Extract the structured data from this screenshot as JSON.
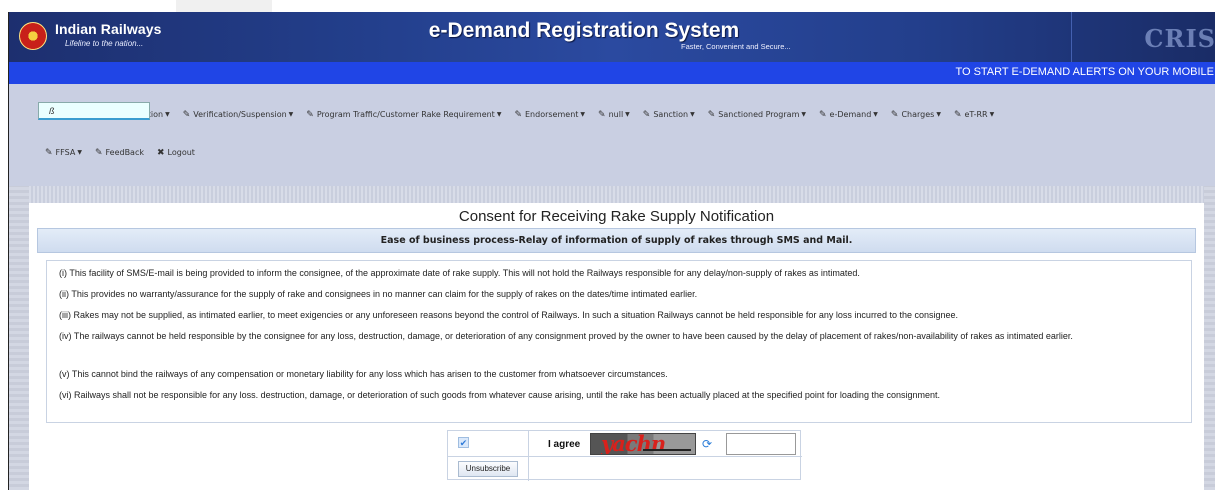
{
  "header": {
    "brand": "Indian Railways",
    "tagline": "Lifeline to the nation...",
    "system_title": "e-Demand Registration System",
    "system_subtitle": "Faster, Convenient and Secure...",
    "right_logo": "CRIS"
  },
  "alert_bar": {
    "text": "TO START E-DEMAND ALERTS ON YOUR MOBILE"
  },
  "nav": {
    "row1": [
      {
        "icon": "home-icon",
        "glyph": "⌂",
        "label": "Home",
        "dropdown": false
      },
      {
        "icon": "user-icon",
        "glyph": "👤",
        "label": "Administration",
        "dropdown": true
      },
      {
        "icon": "pencil-icon",
        "glyph": "✎",
        "label": "Verification/Suspension",
        "dropdown": true
      },
      {
        "icon": "pencil-icon",
        "glyph": "✎",
        "label": "Program Traffic/Customer Rake Requirement",
        "dropdown": true
      },
      {
        "icon": "pencil-icon",
        "glyph": "✎",
        "label": "Endorsement",
        "dropdown": true
      },
      {
        "icon": "pencil-icon",
        "glyph": "✎",
        "label": "null",
        "dropdown": true
      },
      {
        "icon": "pencil-icon",
        "glyph": "✎",
        "label": "Sanction",
        "dropdown": true
      },
      {
        "icon": "pencil-icon",
        "glyph": "✎",
        "label": "Sanctioned Program",
        "dropdown": true
      },
      {
        "icon": "pencil-icon",
        "glyph": "✎",
        "label": "e-Demand",
        "dropdown": true
      },
      {
        "icon": "pencil-icon",
        "glyph": "✎",
        "label": "Charges",
        "dropdown": true
      },
      {
        "icon": "pencil-icon",
        "glyph": "✎",
        "label": "eT-RR",
        "dropdown": true
      }
    ],
    "row2": [
      {
        "icon": "pencil-icon",
        "glyph": "✎",
        "label": "FFSA",
        "dropdown": true
      },
      {
        "icon": "pencil-icon",
        "glyph": "✎",
        "label": "FeedBack",
        "dropdown": false
      },
      {
        "icon": "close-icon",
        "glyph": "✖",
        "label": "Logout",
        "dropdown": false
      }
    ],
    "field_value": "ß"
  },
  "content": {
    "title": "Consent for Receiving Rake Supply Notification",
    "banner": "Ease of business process-Relay of information of supply of rakes through SMS and Mail.",
    "terms": [
      "(i) This facility of SMS/E-mail is being provided to inform the consignee, of the approximate date of rake supply. This will not hold the Railways responsible for any delay/non-supply of rakes as intimated.",
      "(ii) This provides no warranty/assurance for the supply of rake and consignees in no manner can claim for the supply of rakes on the dates/time intimated earlier.",
      "(iii) Rakes may not be supplied, as intimated earlier, to meet exigencies or any unforeseen reasons beyond the control of Railways. In such a situation Railways cannot be held responsible for any loss incurred to the consignee.",
      "(iv) The railways cannot be held responsible by the consignee for any loss, destruction, damage, or deterioration of any consignment proved by the owner to have been caused by the delay of placement of rakes/non-availability of rakes as intimated earlier.",
      "(v) This cannot bind the railways of any compensation or monetary liability for any loss which has arisen to the customer from whatsoever circumstances.",
      "(vi) Railways shall not be responsible for any loss. destruction, damage, or deterioration of such goods from whatever cause arising, until the rake has been actually placed at the specified point for loading the consignment."
    ],
    "agree_label": "I agree",
    "captcha_text": "yachn",
    "captcha_input_value": "",
    "unsubscribe_label": "Unsubscribe",
    "checkbox_checked": true
  }
}
